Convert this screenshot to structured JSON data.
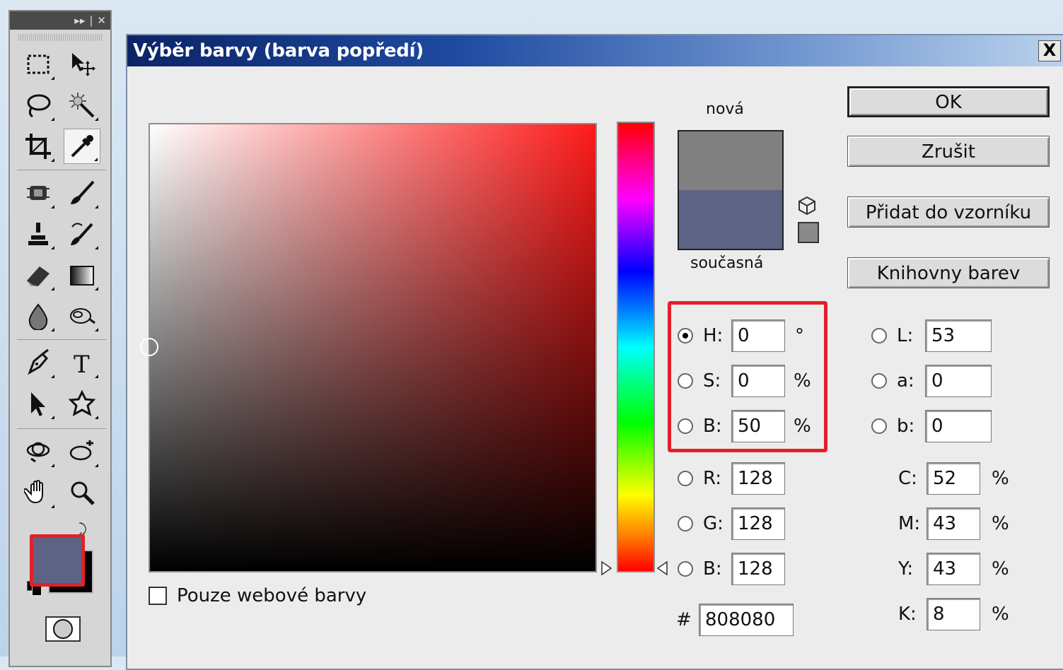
{
  "toolbox": {
    "header_icons": [
      "collapse-arrows-icon",
      "close-icon"
    ],
    "header_text": "▸▸ | ✕",
    "foreground_color": "#5d6385",
    "background_color": "#000000"
  },
  "dialog": {
    "title": "Výběr barvy (barva popředí)",
    "close_label": "X",
    "label_new": "nová",
    "label_current": "současná",
    "new_color": "#808080",
    "current_color": "#5d6385",
    "buttons": {
      "ok": "OK",
      "cancel": "Zrušit",
      "add_to_swatches": "Přidat do vzorníku",
      "color_libraries": "Knihovny barev"
    },
    "web_colors_only": "Pouze webové barvy",
    "hsb": {
      "h_label": "H:",
      "h_value": "0",
      "h_unit": "°",
      "s_label": "S:",
      "s_value": "0",
      "s_unit": "%",
      "b_label": "B:",
      "b_value": "50",
      "b_unit": "%"
    },
    "rgb": {
      "r_label": "R:",
      "r_value": "128",
      "g_label": "G:",
      "g_value": "128",
      "b_label": "B:",
      "b_value": "128"
    },
    "lab": {
      "l_label": "L:",
      "l_value": "53",
      "a_label": "a:",
      "a_value": "0",
      "b_label": "b:",
      "b_value": "0"
    },
    "cmyk": {
      "c_label": "C:",
      "c_value": "52",
      "c_unit": "%",
      "m_label": "M:",
      "m_value": "43",
      "m_unit": "%",
      "y_label": "Y:",
      "y_value": "43",
      "y_unit": "%",
      "k_label": "K:",
      "k_value": "8",
      "k_unit": "%"
    },
    "hex_label": "#",
    "hex_value": "808080",
    "highlight_color": "#e3202a"
  }
}
